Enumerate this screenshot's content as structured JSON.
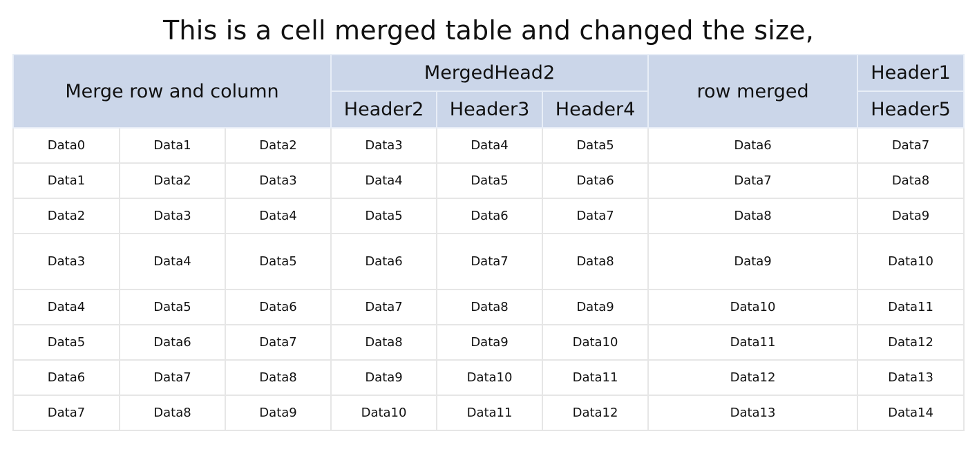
{
  "chart_data": {
    "type": "table",
    "title": "This is a cell merged table and changed the size,",
    "header": {
      "merge_row_and_column": "Merge row and column",
      "merged_head2": "MergedHead2",
      "sub_headers": [
        "Header2",
        "Header3",
        "Header4"
      ],
      "row_merged": "row merged",
      "header1": "Header1",
      "header5": "Header5"
    },
    "rows": [
      [
        "Data0",
        "Data1",
        "Data2",
        "Data3",
        "Data4",
        "Data5",
        "Data6",
        "Data7"
      ],
      [
        "Data1",
        "Data2",
        "Data3",
        "Data4",
        "Data5",
        "Data6",
        "Data7",
        "Data8"
      ],
      [
        "Data2",
        "Data3",
        "Data4",
        "Data5",
        "Data6",
        "Data7",
        "Data8",
        "Data9"
      ],
      [
        "Data3",
        "Data4",
        "Data5",
        "Data6",
        "Data7",
        "Data8",
        "Data9",
        "Data10"
      ],
      [
        "Data4",
        "Data5",
        "Data6",
        "Data7",
        "Data8",
        "Data9",
        "Data10",
        "Data11"
      ],
      [
        "Data5",
        "Data6",
        "Data7",
        "Data8",
        "Data9",
        "Data10",
        "Data11",
        "Data12"
      ],
      [
        "Data6",
        "Data7",
        "Data8",
        "Data9",
        "Data10",
        "Data11",
        "Data12",
        "Data13"
      ],
      [
        "Data7",
        "Data8",
        "Data9",
        "Data10",
        "Data11",
        "Data12",
        "Data13",
        "Data14"
      ]
    ],
    "colors": {
      "header_background": "#cbd6e9",
      "grid_line": "#e6e6e6",
      "text": "#111111"
    }
  }
}
